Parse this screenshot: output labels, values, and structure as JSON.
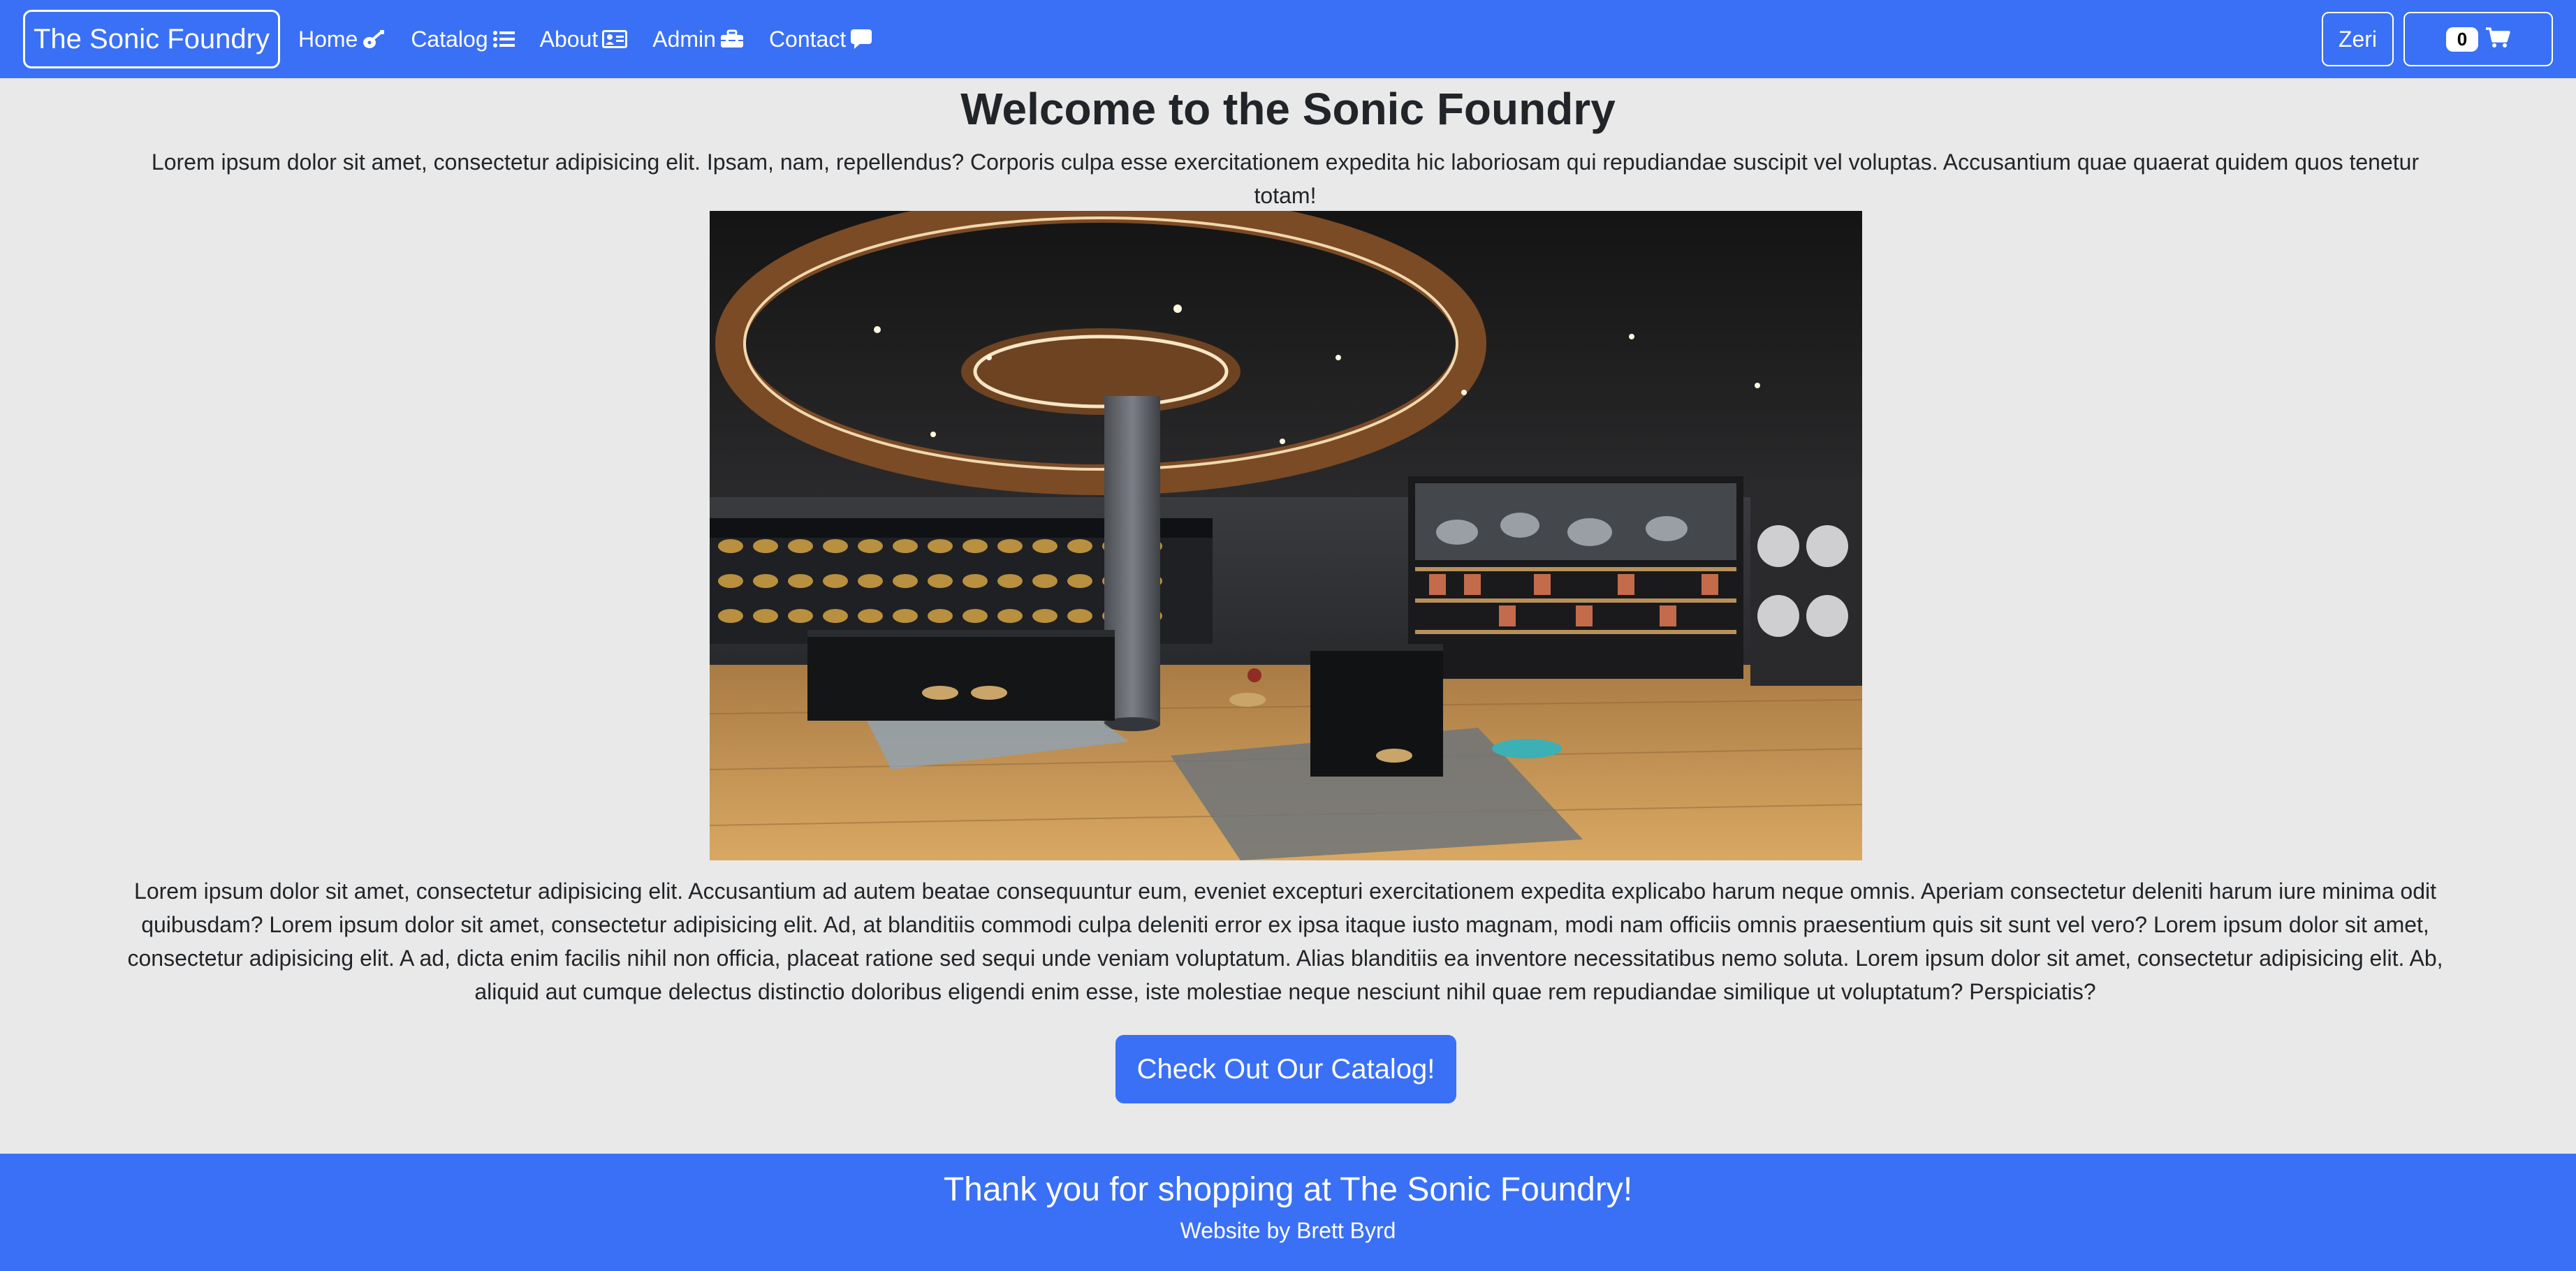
{
  "navbar": {
    "brand": "The Sonic Foundry",
    "links": [
      {
        "label": "Home",
        "icon": "guitar-icon"
      },
      {
        "label": "Catalog",
        "icon": "list-icon"
      },
      {
        "label": "About",
        "icon": "id-card-icon"
      },
      {
        "label": "Admin",
        "icon": "toolbox-icon"
      },
      {
        "label": "Contact",
        "icon": "comment-icon"
      }
    ],
    "user": "Zeri",
    "cart_count": "0"
  },
  "main": {
    "title": "Welcome to the Sonic Foundry",
    "intro": "Lorem ipsum dolor sit amet, consectetur adipisicing elit. Ipsam, nam, repellendus? Corporis culpa esse exercitationem expedita hic laboriosam qui repudiandae suscipit vel voluptas. Accusantium quae quaerat quidem quos tenetur totam!",
    "body": "Lorem ipsum dolor sit amet, consectetur adipisicing elit. Accusantium ad autem beatae consequuntur eum, eveniet excepturi exercitationem expedita explicabo harum neque omnis. Aperiam consectetur deleniti harum iure minima odit quibusdam? Lorem ipsum dolor sit amet, consectetur adipisicing elit. Ad, at blanditiis commodi culpa deleniti error ex ipsa itaque iusto magnam, modi nam officiis omnis praesentium quis sit sunt vel vero? Lorem ipsum dolor sit amet, consectetur adipisicing elit. A ad, dicta enim facilis nihil non officia, placeat ratione sed sequi unde veniam voluptatum. Alias blanditiis ea inventore necessitatibus nemo soluta. Lorem ipsum dolor sit amet, consectetur adipisicing elit. Ab, aliquid aut cumque delectus distinctio doloribus eligendi enim esse, iste molestiae neque nesciunt nihil quae rem repudiandae similique ut voluptatum? Perspiciatis?",
    "cta_label": "Check Out Our Catalog!"
  },
  "footer": {
    "title": "Thank you for shopping at The Sonic Foundry!",
    "credit": "Website by Brett Byrd"
  },
  "colors": {
    "primary": "#3a70f5",
    "background": "#e9e9e9",
    "text": "#212529"
  }
}
